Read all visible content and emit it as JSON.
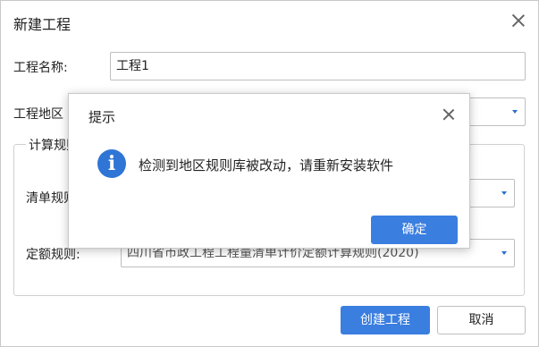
{
  "dialog": {
    "title": "新建工程",
    "project_name_label": "工程名称:",
    "project_name_value": "工程1",
    "project_region_label": "工程地区",
    "calc_rules_legend": "计算规则",
    "bill_rule_label": "清单规则",
    "quota_rule_label": "定额规则:",
    "quota_rule_value": "四川省市政工程工程量清单计价定额计算规则(2020)",
    "create_button": "创建工程",
    "cancel_button": "取消"
  },
  "alert": {
    "title": "提示",
    "message": "检测到地区规则库被改动，请重新安装软件",
    "confirm_button": "确定",
    "icon": "info-icon"
  },
  "colors": {
    "primary": "#3a7ee0",
    "info": "#2f75d6",
    "caret": "#2b6fce"
  }
}
